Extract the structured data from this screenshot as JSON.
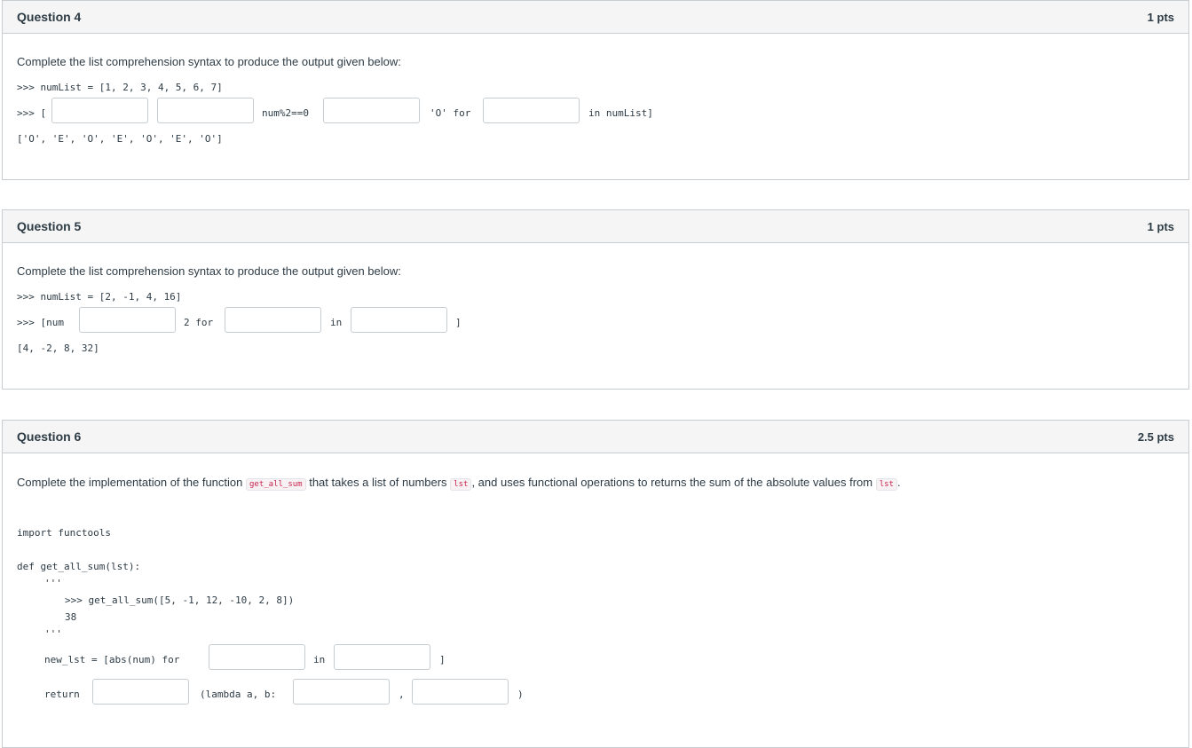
{
  "q4": {
    "title": "Question 4",
    "points": "1 pts",
    "prompt": "Complete the list comprehension syntax to produce the output given below:",
    "line1": ">>> numList = [1, 2, 3, 4, 5, 6, 7]",
    "line2_prefix": ">>> [",
    "line2_mid1": "num%2==0",
    "line2_mid2": "'O' for",
    "line2_suffix": "in numList]",
    "output": "['O', 'E', 'O', 'E', 'O', 'E', 'O']"
  },
  "q5": {
    "title": "Question 5",
    "points": "1 pts",
    "prompt": "Complete the list comprehension syntax to produce the output given below:",
    "line1": ">>> numList = [2, -1, 4, 16]",
    "line2_prefix": ">>> [num",
    "line2_mid1": "2 for",
    "line2_mid2": "in",
    "line2_suffix": "]",
    "output": "[4, -2, 8, 32]"
  },
  "q6": {
    "title": "Question 6",
    "points": "2.5 pts",
    "prompt_a": "Complete the implementation of the function ",
    "fn_code": "get_all_sum",
    "prompt_b": " that takes a list of numbers ",
    "lst_code_1": "lst",
    "prompt_c": ", and uses functional operations to returns the sum of the absolute values from ",
    "lst_code_2": "lst",
    "prompt_d": ".",
    "code_import": "import functools",
    "code_def": "def get_all_sum(lst):",
    "code_doc_open": "'''",
    "code_doctest": ">>> get_all_sum([5, -1, 12, -10, 2, 8])",
    "code_result": "38",
    "code_doc_close": "'''",
    "code_new_lst": "new_lst = [abs(num) for",
    "code_in": "in",
    "code_close_bracket": "]",
    "code_return": "return",
    "code_lambda": "(lambda a, b:",
    "code_comma": ",",
    "code_close_paren": ")"
  }
}
